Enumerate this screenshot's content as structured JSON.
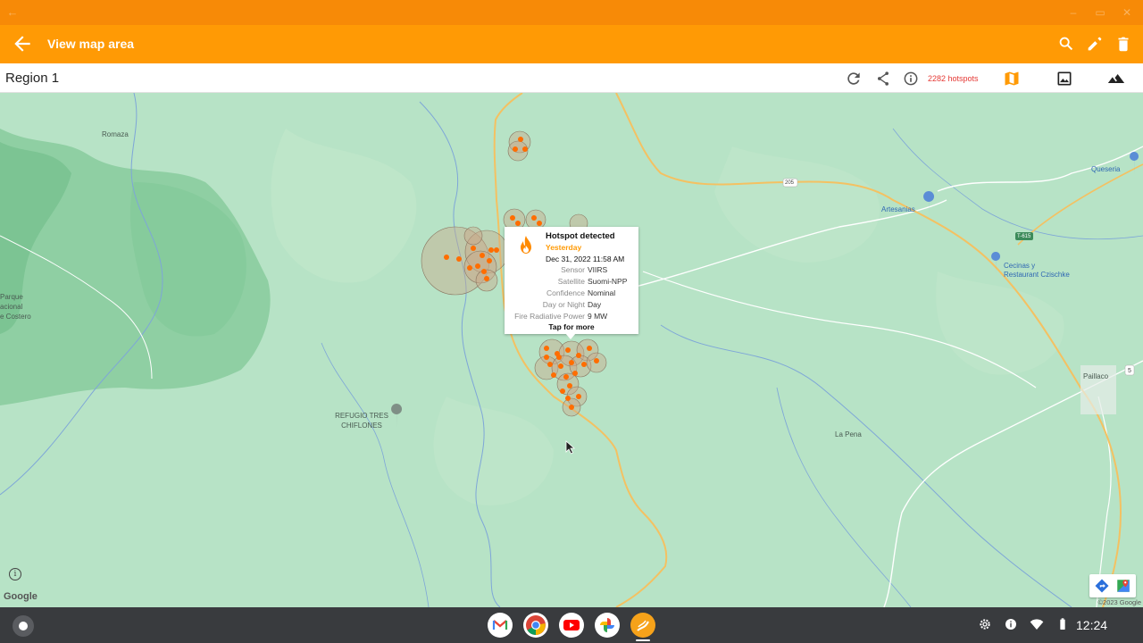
{
  "window": {
    "back_icon": "arrow-left-icon",
    "controls": [
      "minimize-icon",
      "maximize-icon",
      "close-icon"
    ]
  },
  "appbar": {
    "title": "View map area",
    "actions": [
      "search-icon",
      "edit-icon",
      "delete-icon"
    ],
    "color": "#ff9a05"
  },
  "toolbar": {
    "region_name": "Region 1",
    "hotspot_count": "2282 hotspots",
    "icons": [
      "refresh-icon",
      "share-icon",
      "info-icon",
      "map-icon",
      "image-icon",
      "terrain-icon"
    ]
  },
  "map": {
    "labels": {
      "romaza": "Romaza",
      "parque": "Parque",
      "nacional": "acional",
      "costero": "e Costero",
      "refugio_line1": "REFUGIO TRES",
      "refugio_line2": "CHIFLONES",
      "la_pena": "La Pena",
      "paillaco": "Paillaco",
      "queseria": "Queseria",
      "artesanias": "Artesanias",
      "cecinas_line1": "Cecinas y",
      "cecinas_line2": "Restaurant Czischke",
      "route_205": "205",
      "route_t615": "T-615",
      "route_5": "5"
    },
    "google": "Google",
    "copyright": "©2023 Google",
    "hotspot_color": "#ff6d00"
  },
  "popup": {
    "title": "Hotspot detected",
    "when": "Yesterday",
    "date": "Dec 31, 2022 11:58 AM",
    "rows": [
      {
        "key": "Sensor",
        "value": "VIIRS"
      },
      {
        "key": "Satellite",
        "value": "Suomi-NPP"
      },
      {
        "key": "Confidence",
        "value": "Nominal"
      },
      {
        "key": "Day or Night",
        "value": "Day"
      },
      {
        "key": "Fire Radiative Power",
        "value": "9 MW"
      }
    ],
    "tap": "Tap for more"
  },
  "shelf": {
    "apps": [
      "gmail-icon",
      "chrome-icon",
      "youtube-icon",
      "photos-icon",
      "fire-app-icon"
    ],
    "tray": [
      "settings-icon",
      "info-icon",
      "wifi-icon",
      "battery-icon"
    ],
    "time": "12:24"
  }
}
